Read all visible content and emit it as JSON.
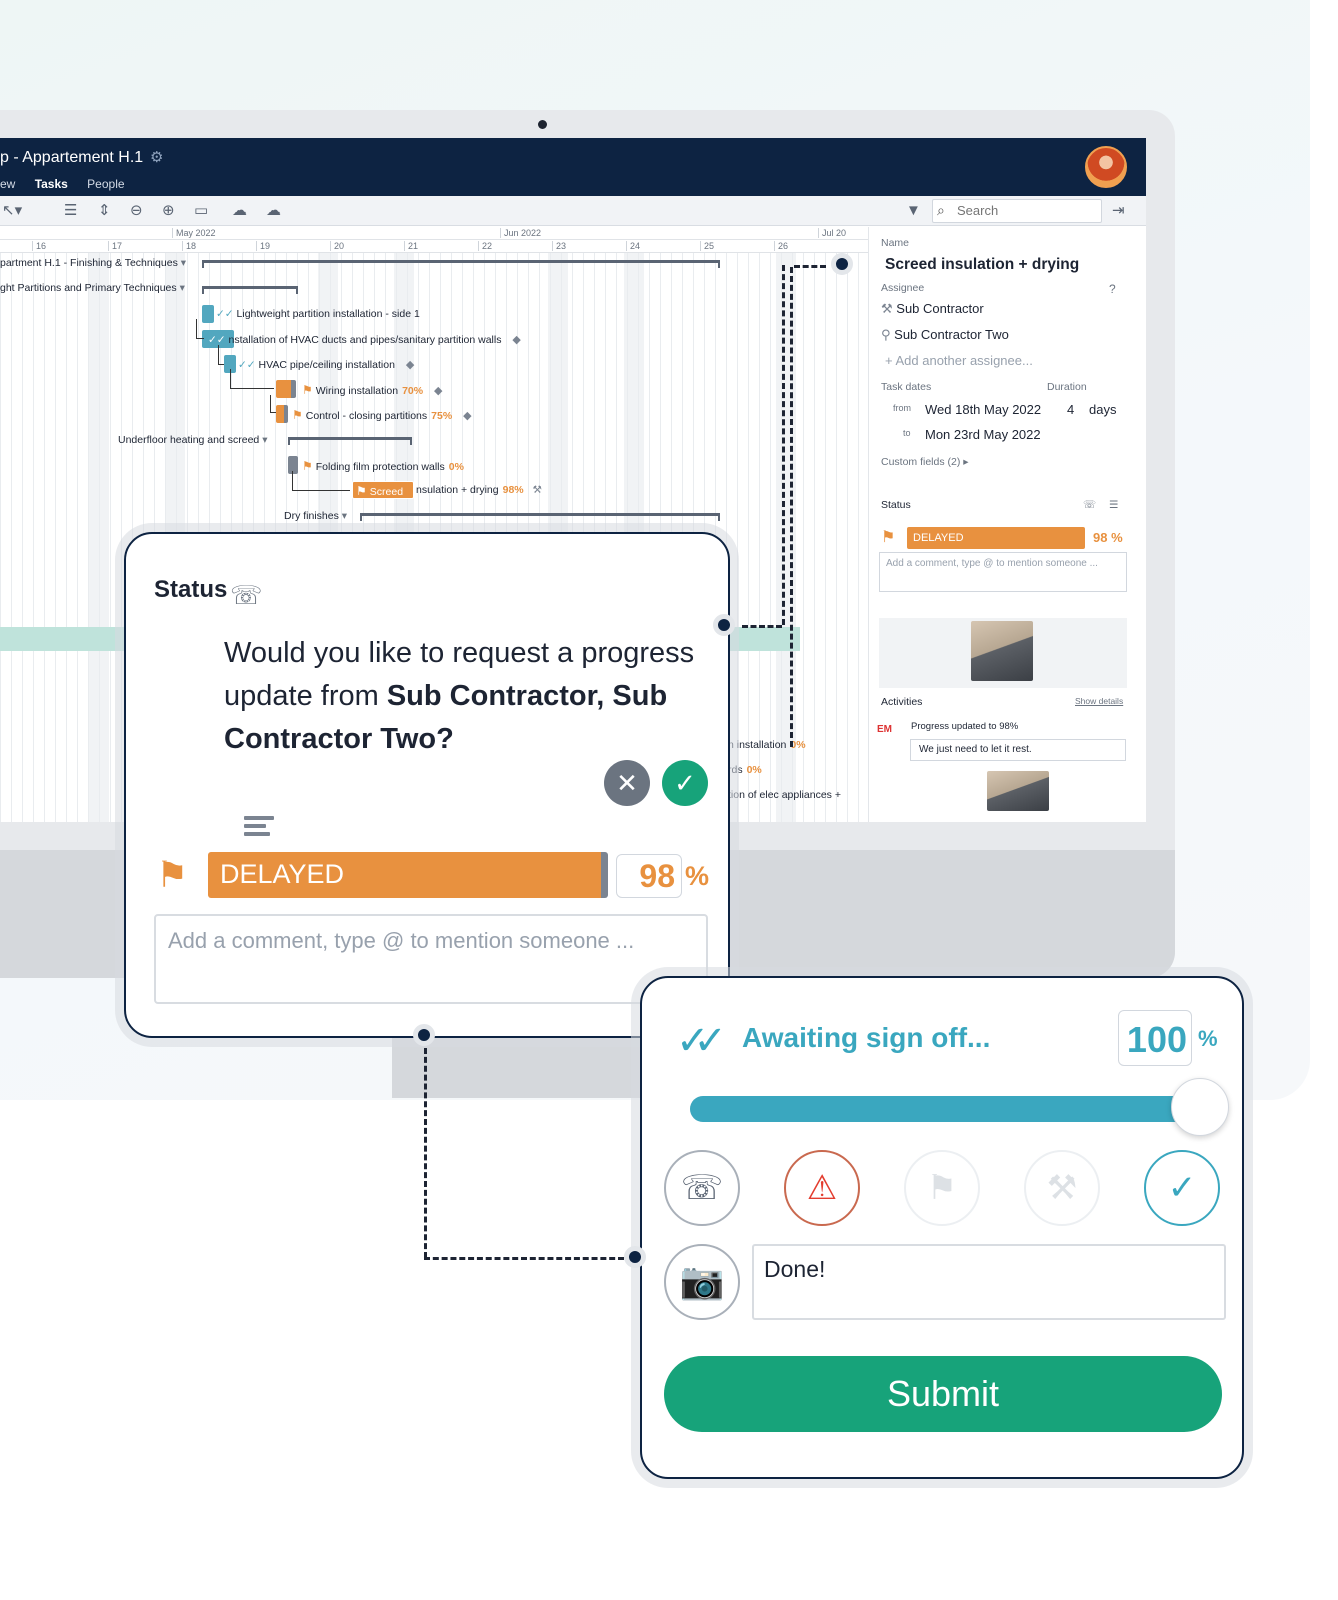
{
  "app": {
    "title": "p - Appartement H.1",
    "nav": [
      "ew",
      "Tasks",
      "People"
    ],
    "active_nav": "Tasks"
  },
  "toolbar": {
    "search_placeholder": "Search"
  },
  "gantt": {
    "months": [
      "May 2022",
      "Jun 2022",
      "Jul 20"
    ],
    "days": [
      "16",
      "17",
      "18",
      "19",
      "20",
      "21",
      "22",
      "23",
      "24",
      "25",
      "26"
    ],
    "rows": [
      {
        "label": "partment H.1 - Finishing & Techniques"
      },
      {
        "label": "ght Partitions and Primary Techniques"
      },
      {
        "label": "Lightweight partition installation - side 1"
      },
      {
        "label": "nstallation of HVAC ducts and pipes/sanitary partition walls"
      },
      {
        "label": "HVAC pipe/ceiling installation"
      },
      {
        "label": "Wiring installation",
        "pct": "70%"
      },
      {
        "label": "Control - closing partitions",
        "pct": "75%"
      },
      {
        "label": "Underfloor heating and screed"
      },
      {
        "label": "Folding film protection walls",
        "pct": "0%"
      },
      {
        "label_bar": "Screed",
        "label": "nsulation + drying",
        "pct": "98%"
      },
      {
        "label": "Dry finishes"
      },
      {
        "label": "n installation",
        "pct": "0%"
      },
      {
        "label": "rds",
        "pct": "0%"
      },
      {
        "label": "tion of elec appliances +"
      }
    ]
  },
  "details": {
    "name_label": "Name",
    "task_name": "Screed insulation + drying",
    "assignee_label": "Assignee",
    "assignees": [
      "Sub Contractor",
      "Sub Contractor Two"
    ],
    "add_assignee": "Add another assignee...",
    "task_dates_label": "Task dates",
    "duration_label": "Duration",
    "from_label": "from",
    "from_date": "Wed 18th May 2022",
    "to_label": "to",
    "to_date": "Mon 23rd May 2022",
    "duration_value": "4",
    "duration_unit": "days",
    "custom_fields": "Custom fields (2)",
    "status_label": "Status",
    "status_value": "DELAYED",
    "status_pct": "98 %",
    "comment_placeholder": "Add a comment, type @ to mention someone ...",
    "activities_label": "Activities",
    "show_details": "Show details",
    "activity_badge": "EM",
    "activity_text": "Progress updated to 98%",
    "activity_note": "We just need to let it rest."
  },
  "status_card": {
    "title": "Status",
    "question_pre": "Would you like to request a progress update from ",
    "question_bold": "Sub Contractor, Sub Contractor Two",
    "question_post": "?",
    "status_value": "DELAYED",
    "progress_value": "98",
    "progress_unit": "%",
    "comment_placeholder": "Add a comment, type @ to mention someone ..."
  },
  "signoff_card": {
    "title": "Awaiting sign off...",
    "progress_value": "100",
    "progress_unit": "%",
    "slider_fraction": 1.0,
    "comment_value": "Done!",
    "submit_label": "Submit"
  },
  "icons": [
    "gear-icon",
    "search-icon",
    "flag-icon",
    "tag-icon",
    "check-icon",
    "close-icon",
    "camera-icon",
    "warning-icon",
    "request-update-icon",
    "worker-icon",
    "list-icon",
    "filter-icon",
    "help-icon"
  ],
  "colors": {
    "navy": "#0d2342",
    "delayed_orange": "#e8913f",
    "signoff_teal": "#3aa7bf",
    "submit_green": "#17a37a",
    "issue_red": "#e33d2f"
  }
}
